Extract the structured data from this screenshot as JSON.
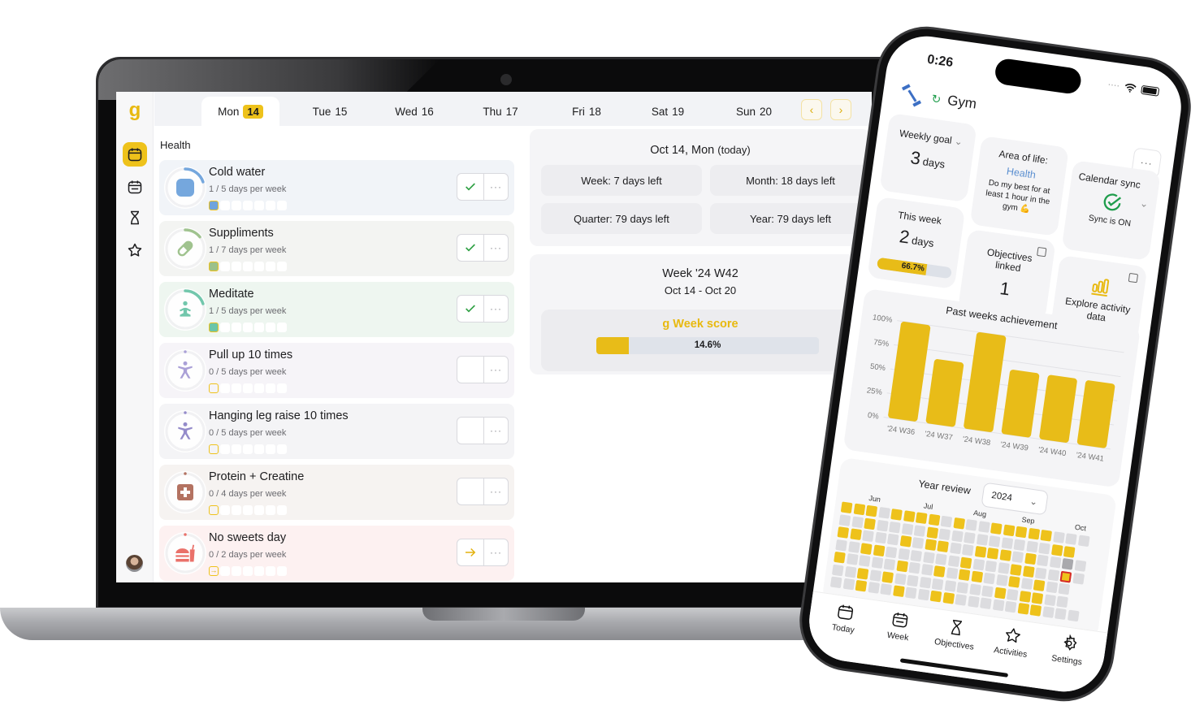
{
  "desktop": {
    "sidebar": {
      "logo": "g",
      "items": [
        {
          "name": "today",
          "icon": "calendar-icon",
          "active": true
        },
        {
          "name": "week",
          "icon": "calendar-week-icon",
          "active": false
        },
        {
          "name": "objectives",
          "icon": "hourglass-icon",
          "active": false
        },
        {
          "name": "activities",
          "icon": "star-icon",
          "active": false
        }
      ]
    },
    "days": [
      {
        "label": "Mon",
        "num": "14",
        "active": true
      },
      {
        "label": "Tue",
        "num": "15",
        "active": false
      },
      {
        "label": "Wed",
        "num": "16",
        "active": false
      },
      {
        "label": "Thu",
        "num": "17",
        "active": false
      },
      {
        "label": "Fri",
        "num": "18",
        "active": false
      },
      {
        "label": "Sat",
        "num": "19",
        "active": false
      },
      {
        "label": "Sun",
        "num": "20",
        "active": false
      }
    ],
    "nav": {
      "prev": "‹",
      "next": "›"
    },
    "section": "Health",
    "habits": [
      {
        "name": "Cold water",
        "freq": "1 / 5 days per week",
        "done": 1,
        "target": 5,
        "status": "check",
        "color": "#6fa3dc",
        "bg": "#f1f4f8",
        "icon": "square-icon"
      },
      {
        "name": "Suppliments",
        "freq": "1 / 7 days per week",
        "done": 1,
        "target": 7,
        "status": "check",
        "color": "#9cc18a",
        "bg": "#f3f4f2",
        "icon": "pill-icon"
      },
      {
        "name": "Meditate",
        "freq": "1 / 5 days per week",
        "done": 1,
        "target": 5,
        "status": "check",
        "color": "#6cc5a9",
        "bg": "#eef6f0",
        "icon": "meditation-icon"
      },
      {
        "name": "Pull up 10 times",
        "freq": "0 / 5 days per week",
        "done": 0,
        "target": 5,
        "status": "empty",
        "color": "#a69cd6",
        "bg": "#f6f4f8",
        "icon": "exercise-icon"
      },
      {
        "name": "Hanging leg raise 10 times",
        "freq": "0 / 5 days per week",
        "done": 0,
        "target": 5,
        "status": "empty",
        "color": "#8f86c8",
        "bg": "#f4f4f6",
        "icon": "exercise-icon"
      },
      {
        "name": "Protein + Creatine",
        "freq": "0 / 4 days per week",
        "done": 0,
        "target": 4,
        "status": "empty",
        "color": "#b06c5a",
        "bg": "#f6f3f1",
        "icon": "first-aid-icon"
      },
      {
        "name": "No sweets day",
        "freq": "0 / 2 days per week",
        "done": 0,
        "target": 2,
        "status": "skip",
        "color": "#ea6b63",
        "bg": "#fdf1f1",
        "icon": "fastfood-icon"
      }
    ],
    "more_label": "···",
    "today_panel": {
      "title": "Oct 14, Mon",
      "suffix": "(today)",
      "cells": [
        "Week: 7 days left",
        "Month: 18 days left",
        "Quarter: 79 days left",
        "Year: 79 days left"
      ]
    },
    "week_panel": {
      "title": "Week '24 W42",
      "range": "Oct 14 - Oct 20",
      "score_label": "Week score",
      "score_pct": 14.6,
      "score_text": "14.6%"
    }
  },
  "phone": {
    "time": "0:26",
    "title": "Gym",
    "more_label": "···",
    "weekly_goal": {
      "label": "Weekly goal",
      "value": "3",
      "unit": "days"
    },
    "area": {
      "label": "Area of life:",
      "name": "Health",
      "desc": "Do my best for at least 1 hour in the gym 💪"
    },
    "calendar_sync": {
      "label": "Calendar sync",
      "status": "Sync is ON"
    },
    "this_week": {
      "label": "This week",
      "value": "2",
      "unit": "days",
      "pct": 66.7,
      "pct_text": "66.7%"
    },
    "objectives": {
      "label": "Objectives linked",
      "value": "1"
    },
    "explore": {
      "label": "Explore activity data"
    },
    "year_review": {
      "label": "Year review",
      "year": "2024",
      "months": [
        "Jun",
        "Jul",
        "Aug",
        "Sep",
        "Oct"
      ]
    },
    "tabbar": [
      {
        "label": "Today",
        "icon": "calendar-icon"
      },
      {
        "label": "Week",
        "icon": "calendar-week-icon"
      },
      {
        "label": "Objectives",
        "icon": "hourglass-icon"
      },
      {
        "label": "Activities",
        "icon": "star-icon"
      },
      {
        "label": "Settings",
        "icon": "gear-icon"
      }
    ]
  },
  "colors": {
    "accent": "#eec21b",
    "success": "#2ea043",
    "sync": "#1f9d4c",
    "link": "#5b8fd0"
  },
  "chart_data": {
    "type": "bar",
    "title": "Past weeks achievement",
    "categories": [
      "'24 W36",
      "'24 W37",
      "'24 W38",
      "'24 W39",
      "'24 W40",
      "'24 W41"
    ],
    "values": [
      100,
      66.7,
      100,
      66.7,
      66.7,
      66.7
    ],
    "yticks": [
      "0%",
      "25%",
      "50%",
      "75%",
      "100%"
    ],
    "ylim": [
      0,
      100
    ],
    "xlabel": "",
    "ylabel": "",
    "grid": true,
    "color": "#e8bc18"
  }
}
